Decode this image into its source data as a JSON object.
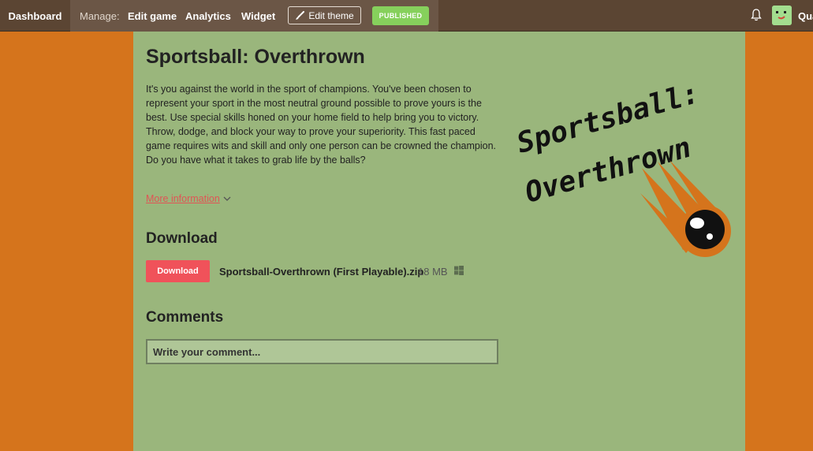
{
  "topbar": {
    "dashboard": "Dashboard",
    "manage_label": "Manage:",
    "edit_game": "Edit game",
    "analytics": "Analytics",
    "widget": "Widget",
    "edit_theme": "Edit theme",
    "published": "PUBLISHED",
    "user_name": "Qua"
  },
  "game": {
    "title": "Sportsball: Overthrown",
    "description": "It's you against the world in the sport of champions. You've been chosen to represent your sport in the most neutral ground possible to prove yours is the best. Use special skills honed on your home field to help bring you to victory. Throw, dodge, and block your way to prove your superiority. This fast paced game requires wits and skill and only one person can be crowned the champion. Do you have what it takes to grab life by the balls?",
    "more_info": "More information",
    "logo_line1": "Sportsball:",
    "logo_line2": "Overthrown"
  },
  "download": {
    "heading": "Download",
    "button": "Download",
    "file_name": "Sportsball-Overthrown (First Playable).zip",
    "file_size": "18 MB",
    "platform_icon": "windows-icon"
  },
  "comments": {
    "heading": "Comments",
    "placeholder": "Write your comment..."
  },
  "colors": {
    "page_background": "#d5741c",
    "content_background": "#9ab67c",
    "topbar": "#5b4533",
    "download_button": "#f0525a",
    "published_badge": "#86d05c"
  }
}
